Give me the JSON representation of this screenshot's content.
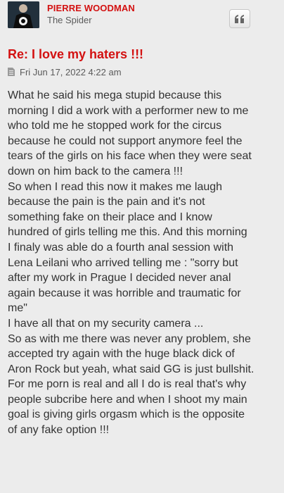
{
  "author": {
    "name": "PIERRE WOODMAN",
    "rank": "The Spider"
  },
  "toolbar": {
    "quote_icon": "quote-icon"
  },
  "post": {
    "title": "Re: I love my haters !!!",
    "post_icon": "post-icon",
    "date": "Fri Jun 17, 2022 4:22 am",
    "lines": [
      "What he said his mega stupid because this",
      "morning I did a work with a performer new to me",
      "who told me he stopped work for the circus",
      "because he could not support anymore feel the",
      "tears of the girls on his face when they were seat",
      "down on him back to the camera !!!",
      "So when I read this now it makes me laugh",
      "because the pain is the pain and it's not",
      "something fake on their place and I know",
      "hundred of girls telling me this. And this morning",
      "I finaly was able do a fourth anal session with",
      "Lena Leilani who arrived telling me : \"sorry but",
      "after my work in Prague I decided never anal",
      "again because it was horrible and traumatic for",
      "me\"",
      "I have all that on my security camera ...",
      "So as with me there was never any problem, she",
      "accepted try again with the huge black dick of",
      "Aron Rock but yeah, what said GG is just bullshit.",
      "For me porn is real and all I do is real that's why",
      "people subcribe here and when I shoot my main",
      "goal is giving girls orgasm which is the opposite",
      "of any fake option !!!"
    ]
  },
  "colors": {
    "accent": "#d31111",
    "background": "#ececec",
    "text": "#333333",
    "muted": "#5a5a5a"
  }
}
